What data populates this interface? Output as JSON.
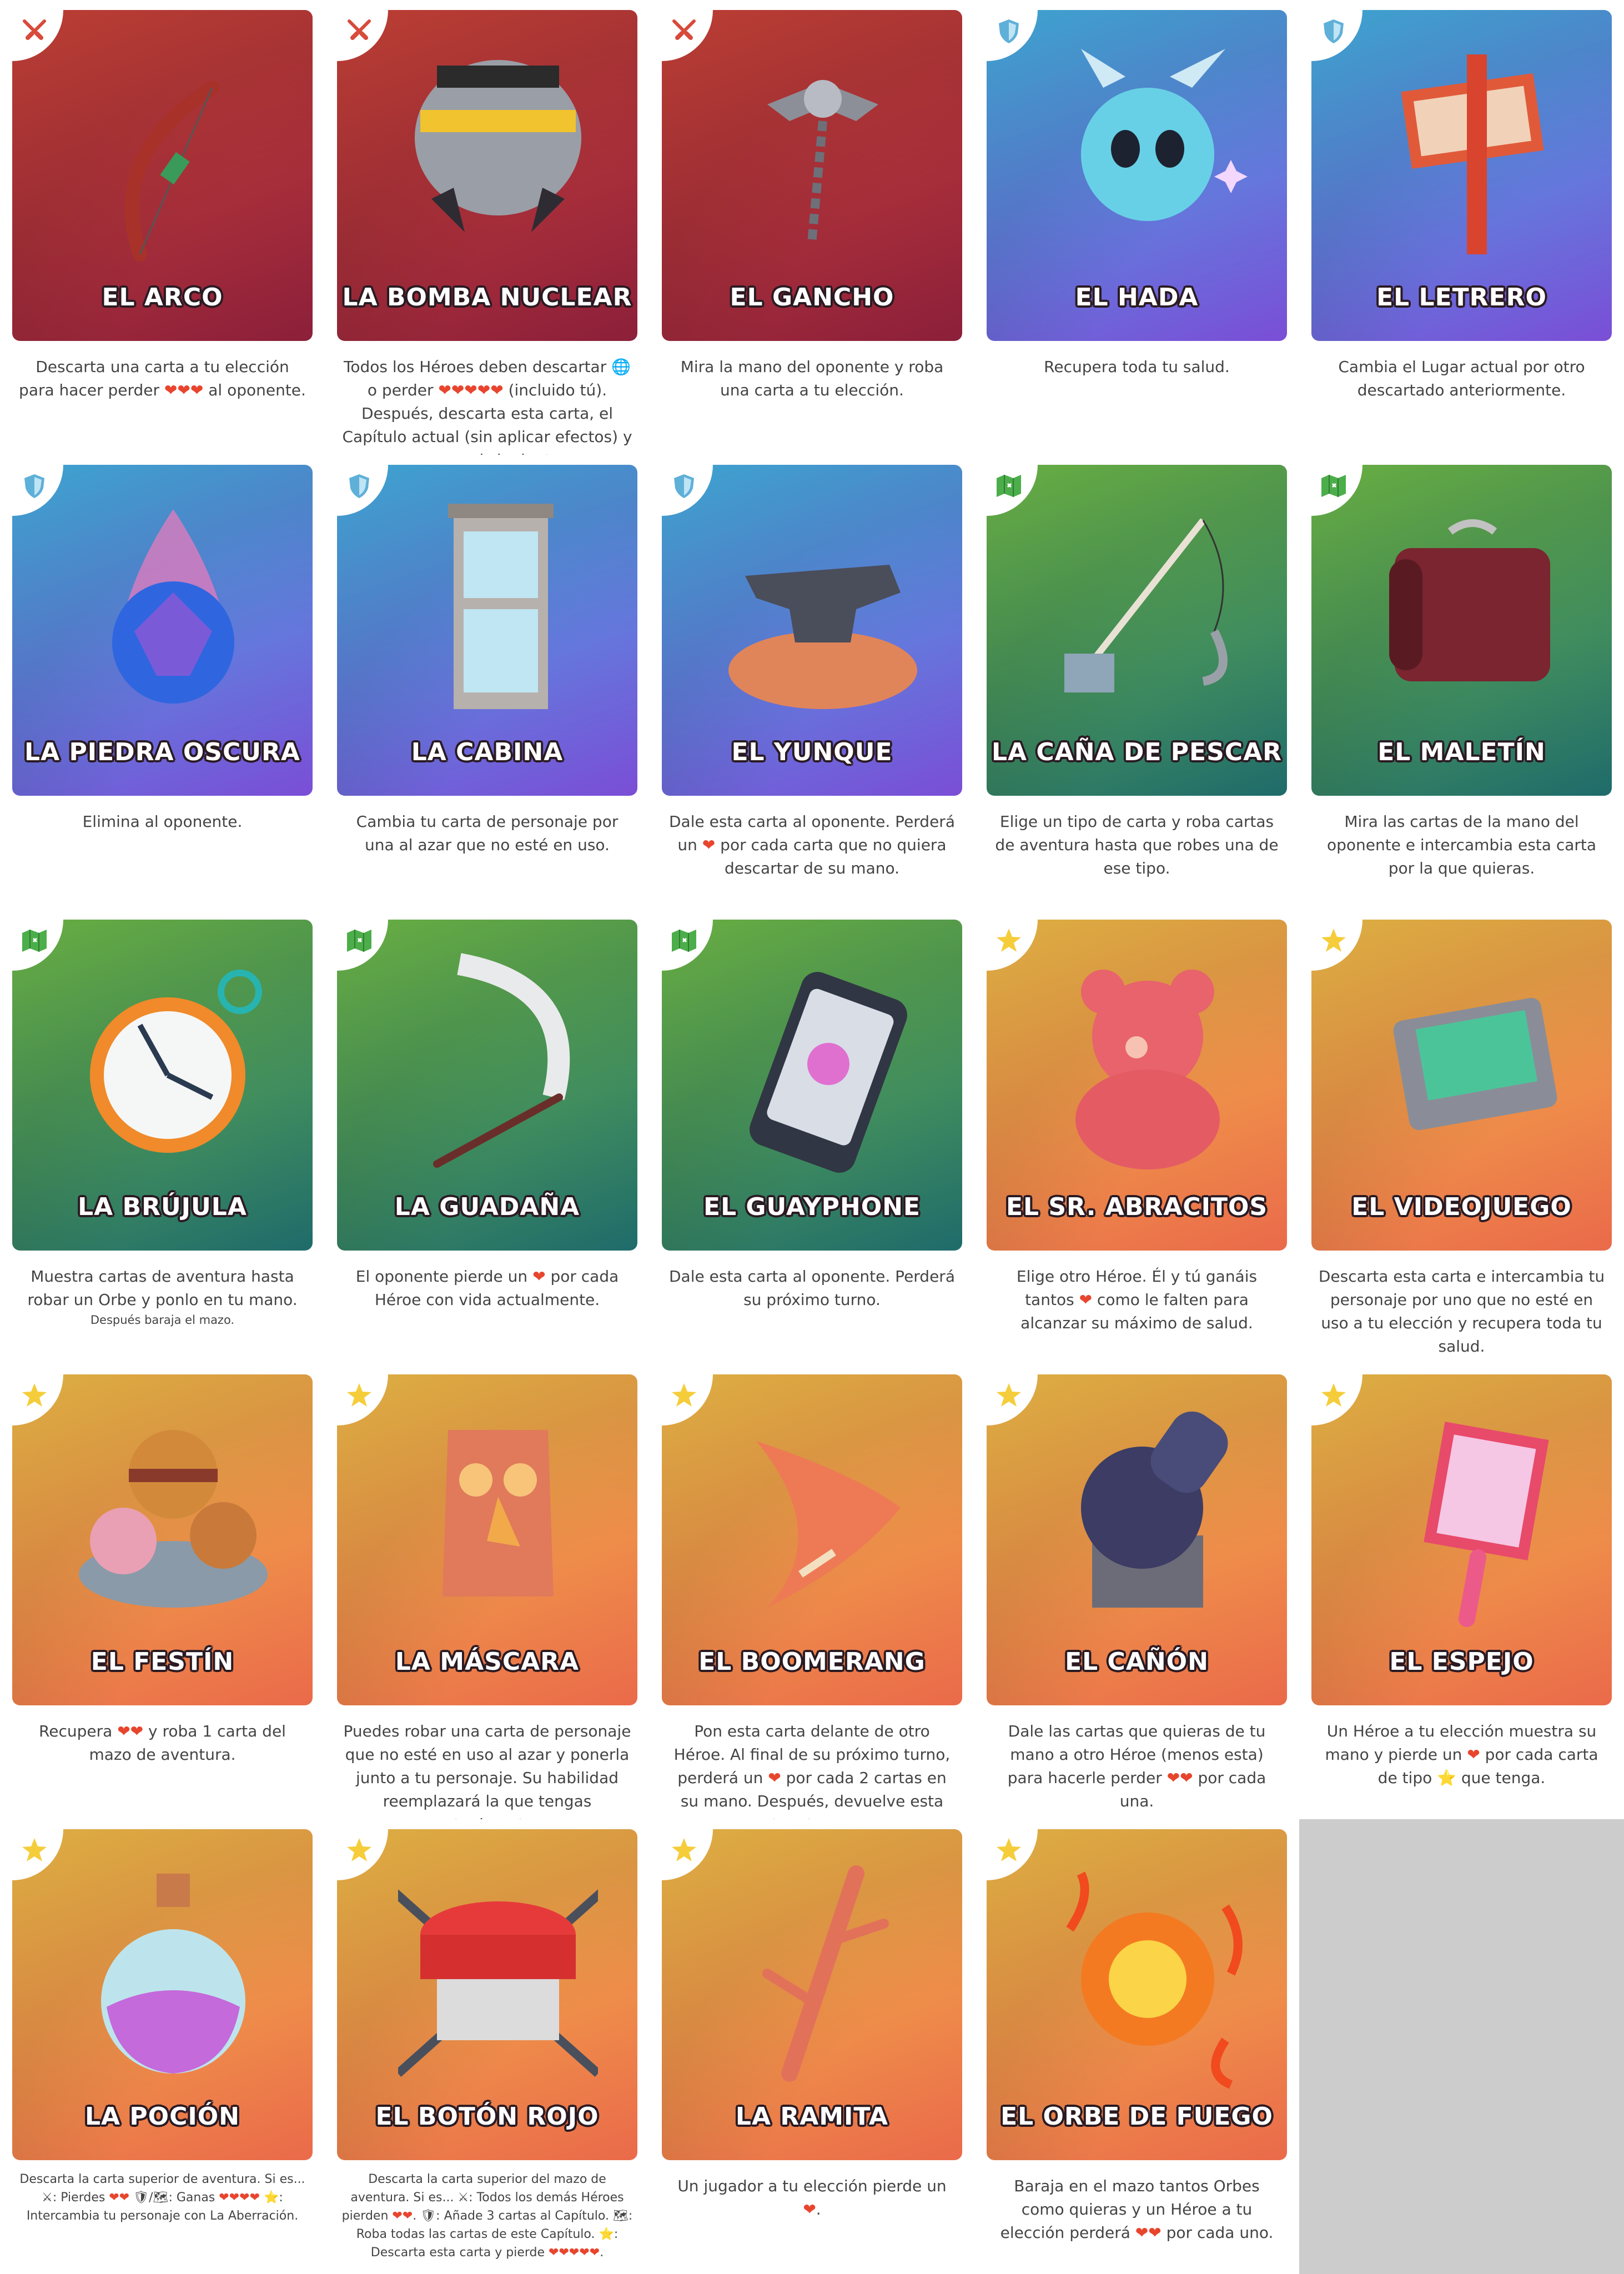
{
  "colors": {
    "attack_red_top": "#d0453a",
    "attack_red_bottom": "#8c1f3a",
    "defense_blue_top": "#44b6e6",
    "defense_blue_bottom": "#7a4ed6",
    "utility_green_top": "#74c24a",
    "utility_green_bottom": "#1f6b6b",
    "star_orange_top": "#f6c24a",
    "star_orange_bottom": "#ea6a4a",
    "heart": "#e8452e",
    "text": "#444444"
  },
  "cards": [
    {
      "title": "EL ARCO",
      "category": "attack",
      "icon": "crossed-swords-icon",
      "art": "bow",
      "desc": "Descarta una carta a tu elección para hacer perder ❤❤❤ al oponente."
    },
    {
      "title": "LA BOMBA NUCLEAR",
      "category": "attack",
      "icon": "crossed-swords-icon",
      "art": "bomb",
      "desc": "Todos los Héroes deben descartar 🌐 o perder ❤❤❤❤❤ (incluido tú). Después, descarta esta carta, el Capítulo actual (sin aplicar efectos) y avanza al siguiente."
    },
    {
      "title": "EL GANCHO",
      "category": "attack",
      "icon": "crossed-swords-icon",
      "art": "hook-chain",
      "desc": "Mira la mano del oponente y roba una carta a tu elección."
    },
    {
      "title": "EL HADA",
      "category": "defense",
      "icon": "shield-icon",
      "art": "fairy",
      "desc": "Recupera toda tu salud."
    },
    {
      "title": "EL LETRERO",
      "category": "defense",
      "icon": "shield-icon",
      "art": "sign",
      "desc": "Cambia el Lugar actual por otro descartado anteriormente."
    },
    {
      "title": "LA PIEDRA OSCURA",
      "category": "defense",
      "icon": "shield-icon",
      "art": "dark-stone",
      "desc": "Elimina al oponente."
    },
    {
      "title": "LA CABINA",
      "category": "defense",
      "icon": "shield-icon",
      "art": "cabin",
      "desc": "Cambia tu carta de personaje por una al azar que no esté en uso."
    },
    {
      "title": "EL YUNQUE",
      "category": "defense",
      "icon": "shield-icon",
      "art": "anvil",
      "desc": "Dale esta carta al oponente. Perderá un ❤ por cada carta que no quiera descartar de su mano."
    },
    {
      "title": "LA CAÑA DE PESCAR",
      "category": "utility",
      "icon": "map-icon",
      "art": "fishing-rod",
      "desc": "Elige un tipo de carta y roba cartas de aventura hasta que robes una de ese tipo."
    },
    {
      "title": "EL MALETÍN",
      "category": "utility",
      "icon": "map-icon",
      "art": "briefcase",
      "desc": "Mira las cartas de la mano del oponente e intercambia esta carta por la que quieras."
    },
    {
      "title": "LA BRÚJULA",
      "category": "utility",
      "icon": "map-icon",
      "art": "compass",
      "desc": "Muestra cartas de aventura hasta robar un Orbe y ponlo en tu mano.",
      "note": "Después baraja el mazo."
    },
    {
      "title": "LA GUADAÑA",
      "category": "utility",
      "icon": "map-icon",
      "art": "scythe",
      "desc": "El oponente pierde un ❤ por cada Héroe con vida actualmente."
    },
    {
      "title": "EL GUAYPHONE",
      "category": "utility",
      "icon": "map-icon",
      "art": "phone",
      "desc": "Dale esta carta al oponente. Perderá su próximo turno."
    },
    {
      "title": "EL SR. ABRACITOS",
      "category": "star",
      "icon": "star-icon",
      "art": "teddy-bear",
      "desc": "Elige otro Héroe. Él y tú ganáis tantos ❤ como le falten para alcanzar su máximo de salud."
    },
    {
      "title": "EL VIDEOJUEGO",
      "category": "star",
      "icon": "star-icon",
      "art": "game-cartridge",
      "desc": "Descarta esta carta e intercambia tu personaje por uno que no esté en uso a tu elección y recupera toda tu salud."
    },
    {
      "title": "EL FESTÍN",
      "category": "star",
      "icon": "star-icon",
      "art": "feast",
      "desc": "Recupera ❤❤ y roba 1 carta del mazo de aventura."
    },
    {
      "title": "LA MÁSCARA",
      "category": "star",
      "icon": "star-icon",
      "art": "mask",
      "desc": "Puedes robar una carta de personaje que no esté en uso al azar y ponerla junto a tu personaje. Su habilidad reemplazará la que tengas actualmente."
    },
    {
      "title": "EL BOOMERANG",
      "category": "star",
      "icon": "star-icon",
      "art": "boomerang",
      "desc": "Pon esta carta delante de otro Héroe. Al final de su próximo turno, perderá un ❤ por cada 2 cartas en su mano. Después, devuelve esta carta a tu mano."
    },
    {
      "title": "EL CAÑÓN",
      "category": "star",
      "icon": "star-icon",
      "art": "cannon",
      "desc": "Dale las cartas que quieras de tu mano a otro Héroe (menos esta) para hacerle perder ❤❤ por cada una."
    },
    {
      "title": "EL ESPEJO",
      "category": "star",
      "icon": "star-icon",
      "art": "mirror",
      "desc": "Un Héroe a tu elección muestra su mano y pierde un ❤ por cada carta de tipo ⭐ que tenga."
    },
    {
      "title": "LA POCIÓN",
      "category": "star",
      "icon": "star-icon",
      "art": "potion",
      "small": true,
      "desc": "Descarta la carta superior de aventura. Si es... ⚔: Pierdes ❤❤ 🛡/🗺: Ganas ❤❤❤❤ ⭐: Intercambia tu personaje con La Aberración."
    },
    {
      "title": "EL BOTÓN ROJO",
      "category": "star",
      "icon": "star-icon",
      "art": "red-button",
      "small": true,
      "desc": "Descarta la carta superior del mazo de aventura. Si es... ⚔: Todos los demás Héroes pierden ❤❤. 🛡: Añade 3 cartas al Capítulo. 🗺: Roba todas las cartas de este Capítulo. ⭐: Descarta esta carta y pierde ❤❤❤❤❤."
    },
    {
      "title": "LA RAMITA",
      "category": "star",
      "icon": "star-icon",
      "art": "twig",
      "desc": "Un jugador a tu elección pierde un ❤."
    },
    {
      "title": "EL ORBE DE FUEGO",
      "category": "star",
      "icon": "star-icon",
      "art": "fire-orb",
      "desc": "Baraja en el mazo tantos Orbes como quieras y un Héroe a tu elección perderá ❤❤ por cada uno."
    }
  ]
}
